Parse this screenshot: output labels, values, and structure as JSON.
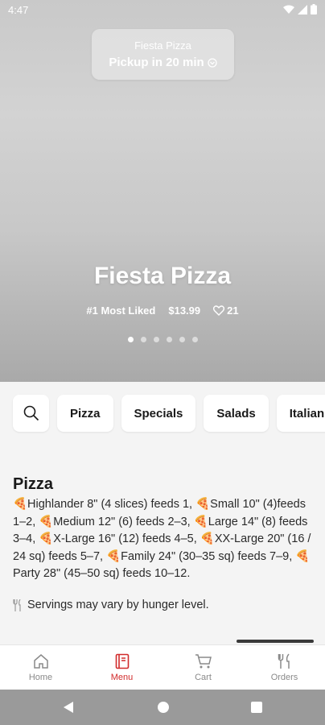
{
  "status_bar": {
    "time": "4:47"
  },
  "pickup": {
    "store_name": "Fiesta Pizza",
    "pickup_text": "Pickup in 20 min"
  },
  "hero": {
    "title": "Fiesta Pizza",
    "badge": "#1 Most Liked",
    "price": "$13.99",
    "likes": "21",
    "carousel": {
      "count": 6,
      "active_index": 0
    }
  },
  "categories": [
    "Pizza",
    "Specials",
    "Salads",
    "Italian"
  ],
  "section": {
    "title": "Pizza",
    "description": "🍕Highlander 8\" (4 slices) feeds 1, 🍕Small 10\" (4)feeds 1–2, 🍕Medium 12\" (6) feeds 2–3, 🍕Large 14\" (8) feeds 3–4, 🍕X-Large 16\" (12) feeds 4–5, 🍕XX-Large 20\" (16 / 24 sq) feeds 5–7, 🍕Family 24\" (30–35 sq) feeds 7–9, 🍕Party 28\" (45–50 sq) feeds 10–12.",
    "note": "Servings may vary by hunger level."
  },
  "bottom_nav": [
    {
      "label": "Home",
      "icon": "home-icon",
      "active": false
    },
    {
      "label": "Menu",
      "icon": "menu-book-icon",
      "active": true
    },
    {
      "label": "Cart",
      "icon": "cart-icon",
      "active": false
    },
    {
      "label": "Orders",
      "icon": "utensils-icon",
      "active": false
    }
  ],
  "colors": {
    "accent": "#d12b2b",
    "inactive": "#8a8a8a"
  }
}
